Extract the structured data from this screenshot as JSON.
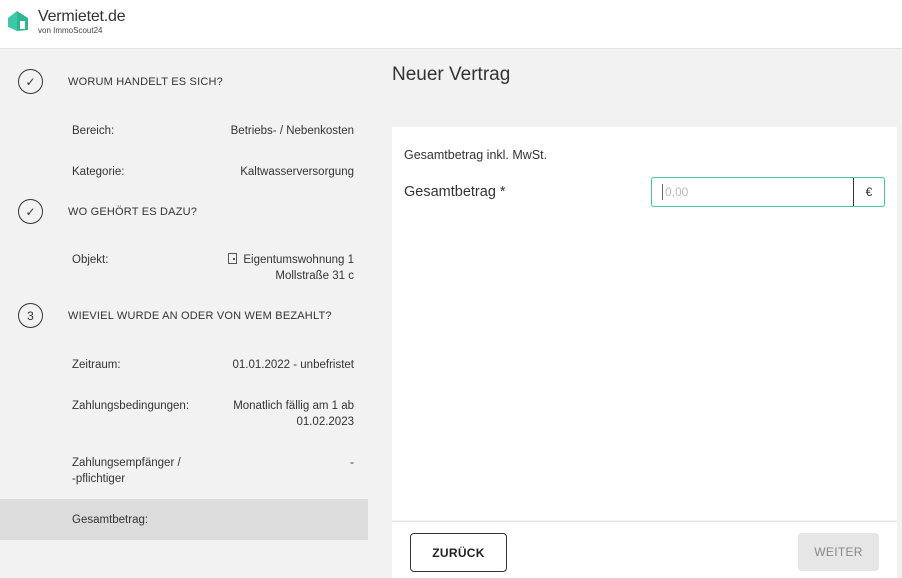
{
  "app": {
    "name": "Vermietet.de",
    "sub": "von ImmoScout24",
    "brand_color": "#3dc9a7"
  },
  "steps": [
    {
      "marker": "✓",
      "title": "WORUM HANDELT ES SICH?"
    },
    {
      "marker": "✓",
      "title": "WO GEHÖRT ES DAZU?"
    },
    {
      "marker": "3",
      "title": "WIEVIEL WURDE AN ODER VON WEM BEZAHLT?"
    }
  ],
  "rows": {
    "bereich": {
      "label": "Bereich:",
      "value": "Betriebs- / Nebenkosten"
    },
    "kategorie": {
      "label": "Kategorie:",
      "value": "Kaltwasserversorgung"
    },
    "objekt": {
      "label": "Objekt:",
      "value_line1": "Eigentumswohnung 1",
      "value_line2": "Mollstraße 31 c"
    },
    "zeitraum": {
      "label": "Zeitraum:",
      "value": "01.01.2022 - unbefristet"
    },
    "zahlungsbedingungen": {
      "label": "Zahlungsbedingungen:",
      "value_line1": "Monatlich fällig am 1 ab",
      "value_line2": "01.02.2023"
    },
    "empfaenger": {
      "label_line1": "Zahlungsempfänger /",
      "label_line2": "-pflichtiger",
      "value": "-"
    },
    "gesamtbetrag": {
      "label": "Gesamtbetrag:",
      "value": ""
    }
  },
  "main": {
    "title": "Neuer Vertrag",
    "subtitle": "Gesamtbetrag inkl. MwSt.",
    "field_label": "Gesamtbetrag *",
    "field_placeholder": "0,00",
    "currency": "€"
  },
  "footer": {
    "back_label": "ZURÜCK",
    "next_label": "WEITER"
  }
}
